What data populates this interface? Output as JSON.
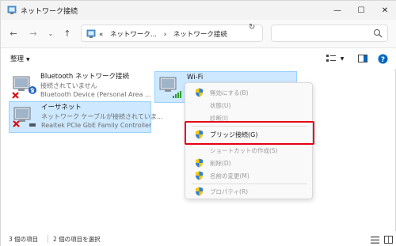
{
  "window": {
    "title": "ネットワーク接続",
    "minimize_glyph": "—",
    "maximize_glyph": "☐",
    "close_glyph": "✕"
  },
  "nav": {
    "back_glyph": "←",
    "forward_glyph": "→",
    "recent_glyph": "⌄",
    "up_glyph": "↑"
  },
  "address": {
    "overflow": "«",
    "crumbs": [
      "ネットワーク...",
      "ネットワーク接続"
    ],
    "separator": "›",
    "dropdown_glyph": "⌄",
    "refresh_glyph": "↻"
  },
  "search": {
    "placeholder": ""
  },
  "toolbar": {
    "organize_label": "整理",
    "organize_caret": "▼",
    "view_caret": "▼"
  },
  "adapters": [
    {
      "name": "Bluetooth ネットワーク接続",
      "status": "接続されていません",
      "device": "Bluetooth Device (Personal Area ...",
      "icon": "bluetooth-adapter-disabled-icon"
    },
    {
      "name": "イーサネット",
      "status": "ネットワーク ケーブルが接続されていま...",
      "device": "Realtek PCIe GbE Family Controller",
      "icon": "ethernet-adapter-disconnected-icon"
    },
    {
      "name": "Wi-Fi",
      "status": "",
      "device": "",
      "icon": "wifi-adapter-icon"
    }
  ],
  "context_menu": {
    "items": [
      {
        "label": "無効にする(B)",
        "enabled": false,
        "shield": true
      },
      {
        "label": "状態(U)",
        "enabled": false,
        "shield": false
      },
      {
        "label": "診断(I)",
        "enabled": false,
        "shield": false
      },
      {
        "label": "ブリッジ接続(G)",
        "enabled": true,
        "shield": true
      },
      {
        "label": "ショートカットの作成(S)",
        "enabled": false,
        "shield": false
      },
      {
        "label": "削除(D)",
        "enabled": false,
        "shield": true
      },
      {
        "label": "名前の変更(M)",
        "enabled": false,
        "shield": true
      },
      {
        "label": "プロパティ(R)",
        "enabled": false,
        "shield": true
      }
    ]
  },
  "status_bar": {
    "item_count": "3 個の項目",
    "selected_count": "2 個の項目を選択"
  },
  "colors": {
    "selection_bg": "#cde8ff",
    "highlight_border": "#e60012",
    "accent": "#0067c0"
  }
}
